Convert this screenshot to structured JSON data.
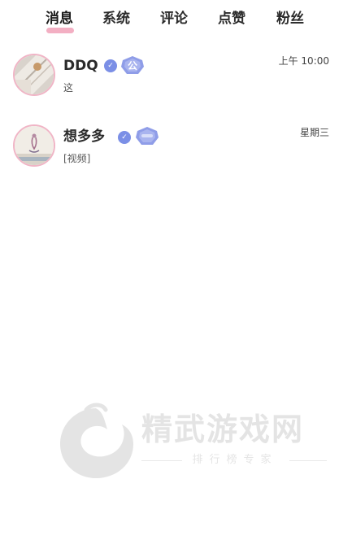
{
  "tabs": [
    {
      "label": "消息",
      "active": true
    },
    {
      "label": "系统",
      "active": false
    },
    {
      "label": "评论",
      "active": false
    },
    {
      "label": "点赞",
      "active": false
    },
    {
      "label": "粉丝",
      "active": false
    }
  ],
  "messages": [
    {
      "name": "DDQ",
      "preview": "这",
      "time": "上午 10:00",
      "level_badge": "公",
      "avatar": "photo-avatar"
    },
    {
      "name": "想多多",
      "preview": "[视频]",
      "time": "星期三",
      "level_badge": "",
      "avatar": "photo-avatar"
    }
  ],
  "watermark": {
    "title": "精武游戏网",
    "subtitle": "排行榜专家"
  },
  "colors": {
    "tab_underline": "#f2a6bd",
    "avatar_border": "#f0b5c6",
    "verify_badge": "#7b8fe6",
    "level_badge": "#8f9de8"
  }
}
